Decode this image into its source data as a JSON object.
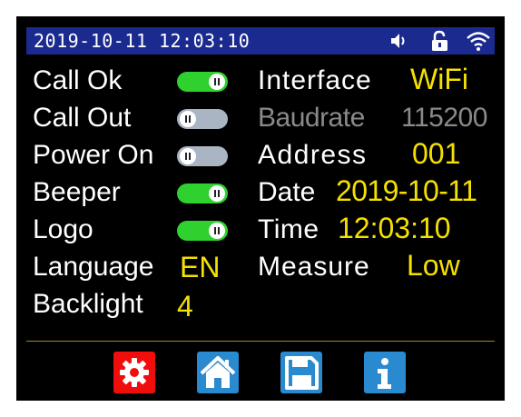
{
  "status": {
    "datetime": "2019-10-11  12:03:10",
    "icons": [
      "speaker-icon",
      "lock-icon",
      "wifi-icon"
    ],
    "bar_color": "#1b2a8f"
  },
  "settings_left": [
    {
      "label": "Call   Ok",
      "toggle": "on"
    },
    {
      "label": "Call   Out",
      "toggle": "off"
    },
    {
      "label": "Power On",
      "toggle": "off"
    },
    {
      "label": "Beeper",
      "toggle": "on"
    },
    {
      "label": "Logo",
      "toggle": "on"
    }
  ],
  "language": {
    "label": "Language",
    "value": "EN"
  },
  "backlight": {
    "label": "Backlight",
    "value": "4"
  },
  "settings_right": {
    "interface": {
      "label": "Interface",
      "value": "WiFi"
    },
    "baudrate": {
      "label": "Baudrate",
      "value": "115200"
    },
    "address": {
      "label": "Address",
      "value": "001"
    },
    "date": {
      "label": "Date",
      "value": "2019-10-11"
    },
    "time": {
      "label": "Time",
      "value": "12:03:10"
    },
    "measure": {
      "label": "Measure",
      "value": "Low"
    }
  },
  "footer_buttons": [
    "settings-icon",
    "home-icon",
    "save-icon",
    "info-icon"
  ],
  "colors": {
    "value": "#f5e000",
    "toggle_on": "#2fd12f",
    "toggle_off": "#aab5c4",
    "settings_button": "#f20d0d",
    "nav_button": "#2a8ad0"
  }
}
